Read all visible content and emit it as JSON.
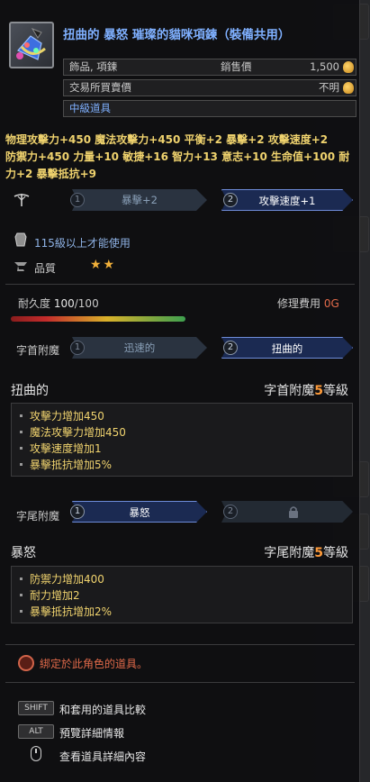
{
  "item": {
    "title": "扭曲的 暴怒 璀璨的貓咪項鍊（裝備共用）",
    "category": "飾品, 項鍊",
    "sell_label": "銷售價",
    "sell_price": "1,500",
    "trade_label": "交易所買賣價",
    "trade_value": "不明",
    "grade": "中級道具"
  },
  "stats_line1": "物理攻擊力+450 魔法攻擊力+450 平衡+2 暴擊+2 攻擊速度+2",
  "stats_line2": "防禦力+450 力量+10 敏捷+16 智力+13 意志+10 生命值+100 耐力+2 暴擊抵抗+9",
  "weapon_bar": {
    "slot1_num": "1",
    "slot1_label": "暴擊+2",
    "slot2_num": "2",
    "slot2_label": "攻擊速度+1"
  },
  "requirement": "115級以上才能使用",
  "quality_label": "品質",
  "quality_stars": "★★",
  "durability": {
    "label": "耐久度",
    "current": "100",
    "max": "/100",
    "fraction": 1.0
  },
  "repair": {
    "label": "修理費用",
    "cost": "0G"
  },
  "prefix": {
    "label": "字首附魔",
    "opt1_num": "1",
    "opt1": "迅速的",
    "opt2_num": "2",
    "opt2": "扭曲的",
    "name": "扭曲的",
    "level_prefix": "字首附魔",
    "level_num": "5",
    "level_suffix": "等級",
    "effects": [
      "攻擊力增加450",
      "魔法攻擊力增加450",
      "攻擊速度增加1",
      "暴擊抵抗增加5%"
    ]
  },
  "suffix": {
    "label": "字尾附魔",
    "opt1_num": "1",
    "opt1": "暴怒",
    "opt2_num": "2",
    "name": "暴怒",
    "level_prefix": "字尾附魔",
    "level_num": "5",
    "level_suffix": "等級",
    "effects": [
      "防禦力增加400",
      "耐力增加2",
      "暴擊抵抗增加2%"
    ]
  },
  "bound_text": "綁定於此角色的道具。",
  "hints": {
    "shift_key": "SHIFT",
    "shift_text": "和套用的道具比較",
    "alt_key": "ALT",
    "alt_text": "預覽詳細情報",
    "mouse_text": "查看道具詳細內容"
  }
}
